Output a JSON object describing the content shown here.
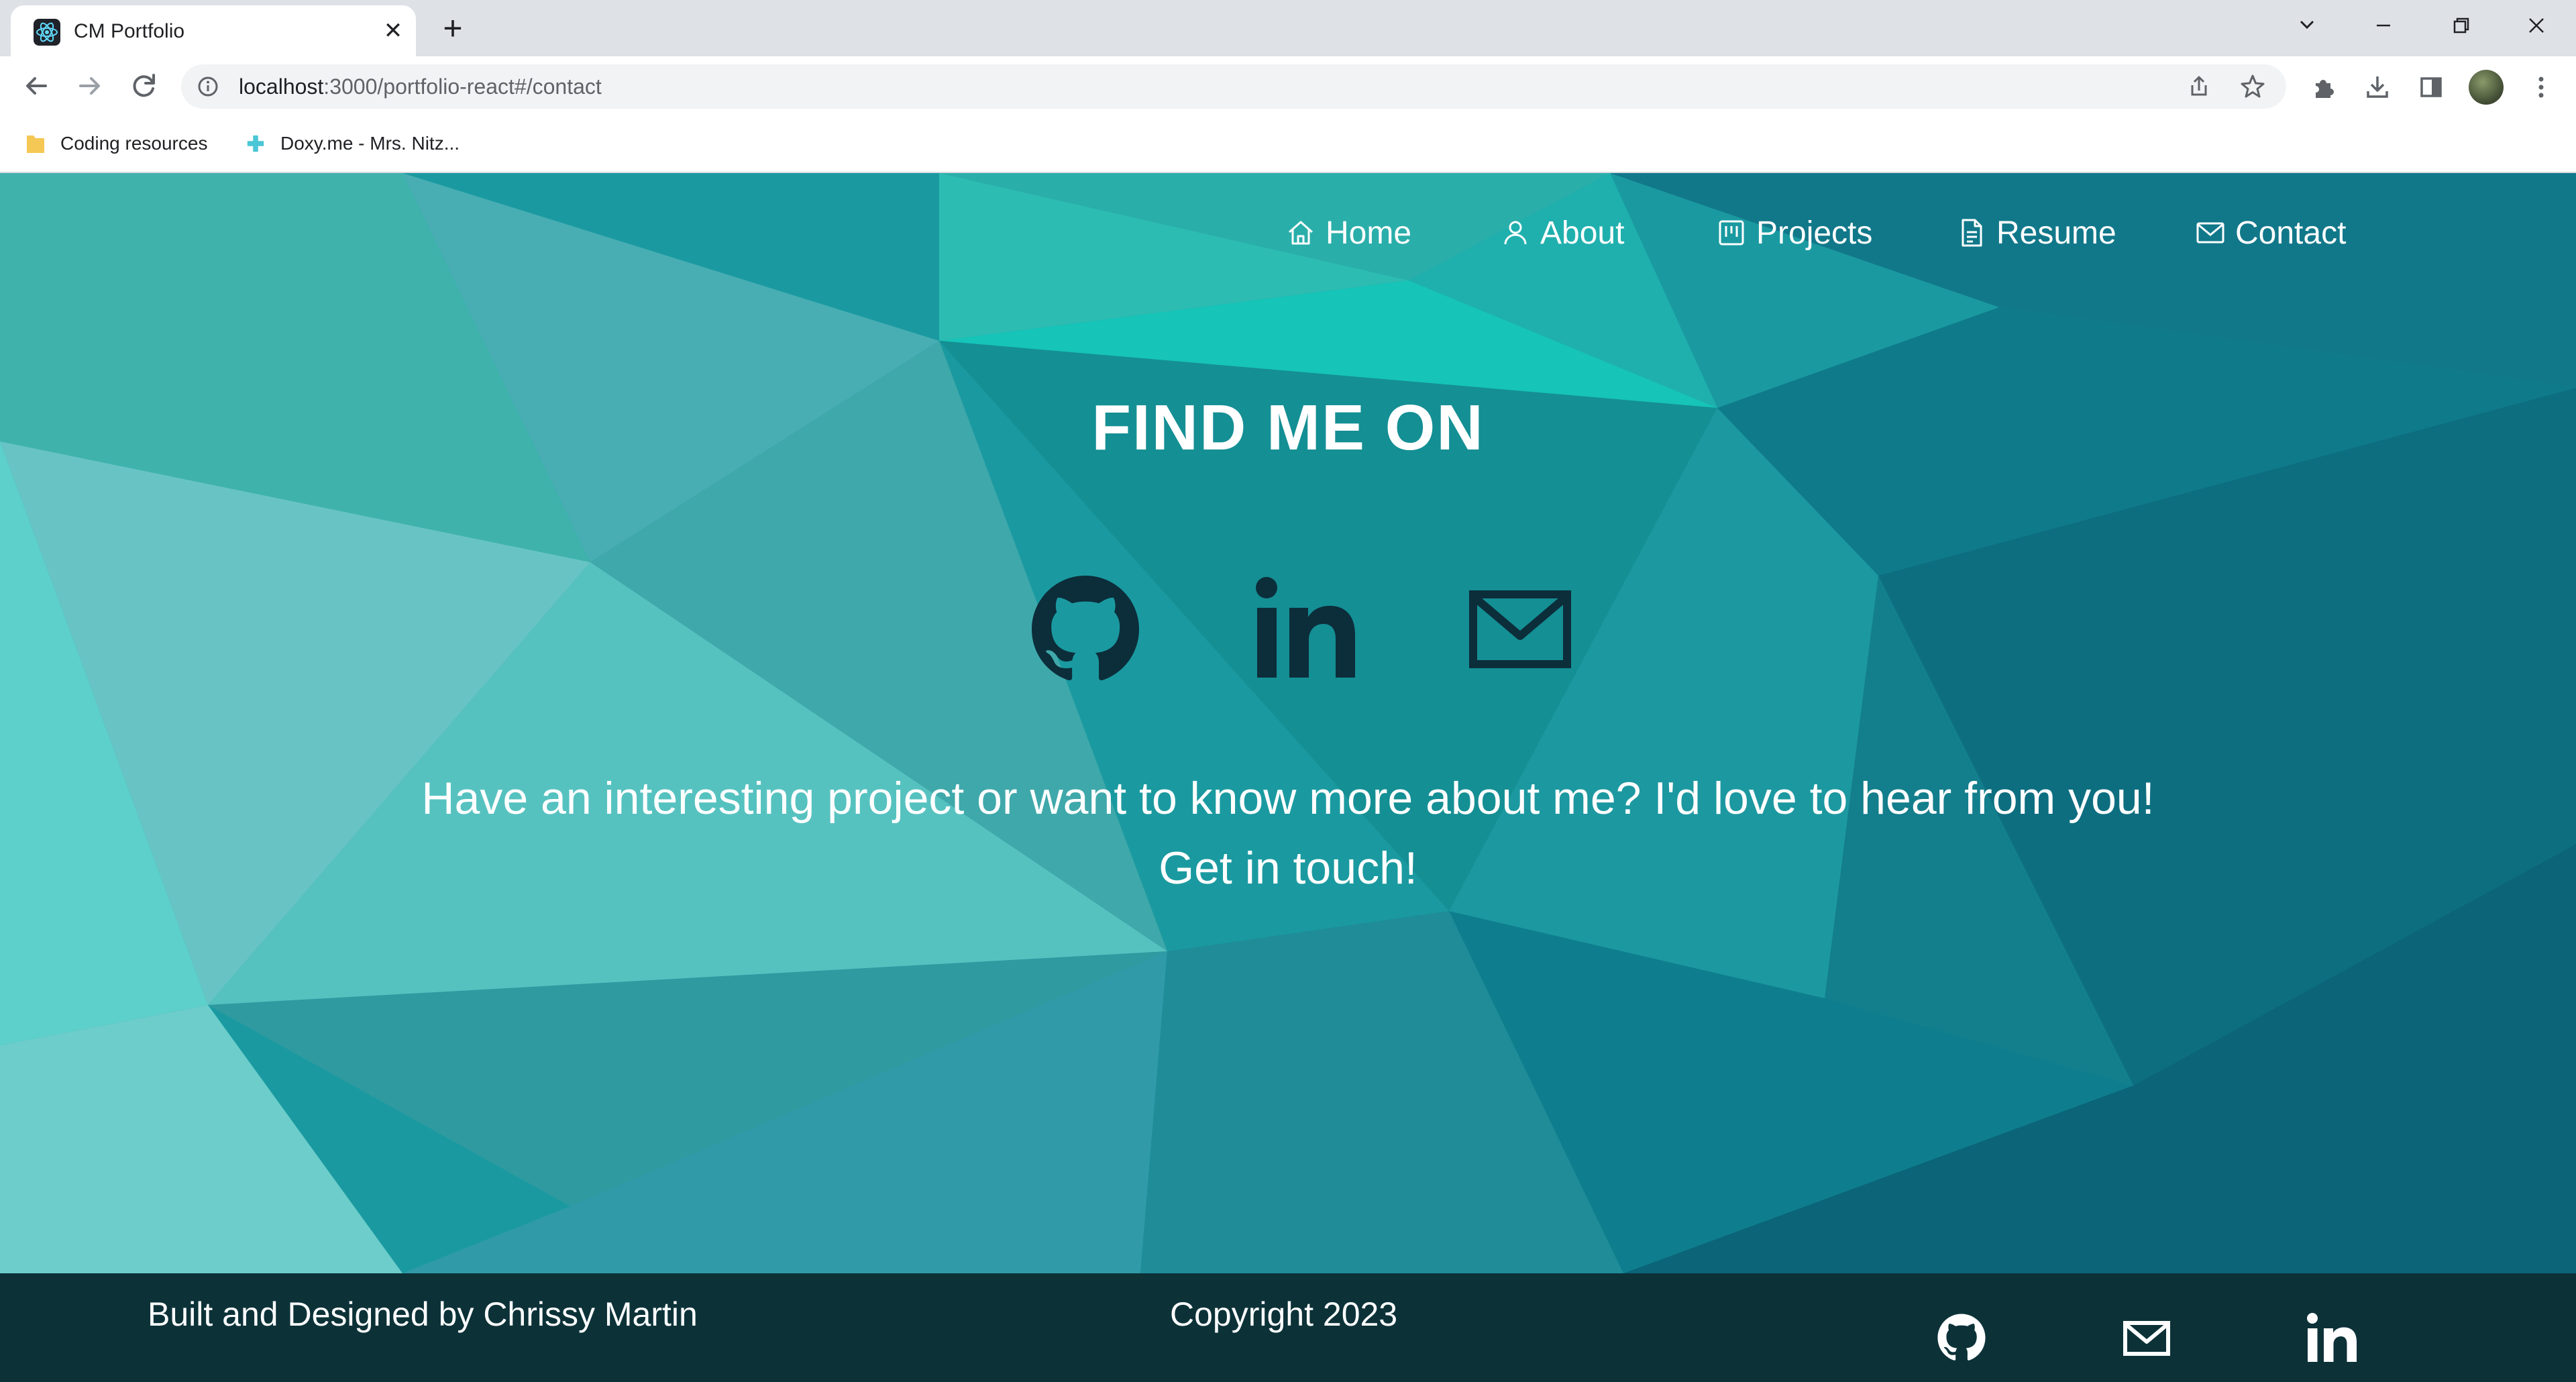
{
  "browser": {
    "tab_title": "CM Portfolio",
    "tab_close": "✕",
    "new_tab": "+",
    "url_host": "localhost",
    "url_path": ":3000/portfolio-react#/contact",
    "bookmarks": [
      {
        "label": "Coding resources",
        "icon": "folder-icon"
      },
      {
        "label": "Doxy.me - Mrs. Nitz...",
        "icon": "doxy-icon"
      }
    ]
  },
  "nav": {
    "items": [
      {
        "label": "Home",
        "icon": "home-icon"
      },
      {
        "label": "About",
        "icon": "user-icon"
      },
      {
        "label": "Projects",
        "icon": "projects-icon"
      },
      {
        "label": "Resume",
        "icon": "document-icon"
      },
      {
        "label": "Contact",
        "icon": "mail-icon"
      }
    ]
  },
  "contact": {
    "heading": "FIND ME ON",
    "social": [
      "github-icon",
      "linkedin-icon",
      "email-icon"
    ],
    "message_line1": "Have an interesting project or want to know more about me? I'd love to hear from you!",
    "message_line2": "Get in touch!"
  },
  "footer": {
    "credit": "Built and Designed by Chrissy Martin",
    "copyright": "Copyright 2023",
    "icons": [
      "github-icon",
      "mail-icon",
      "linkedin-icon"
    ]
  },
  "colors": {
    "teal_light": "#5fd0c8",
    "teal_dark": "#0b6f82",
    "footer_bg": "#0c3238",
    "icon_dark": "#0c2d3a"
  }
}
